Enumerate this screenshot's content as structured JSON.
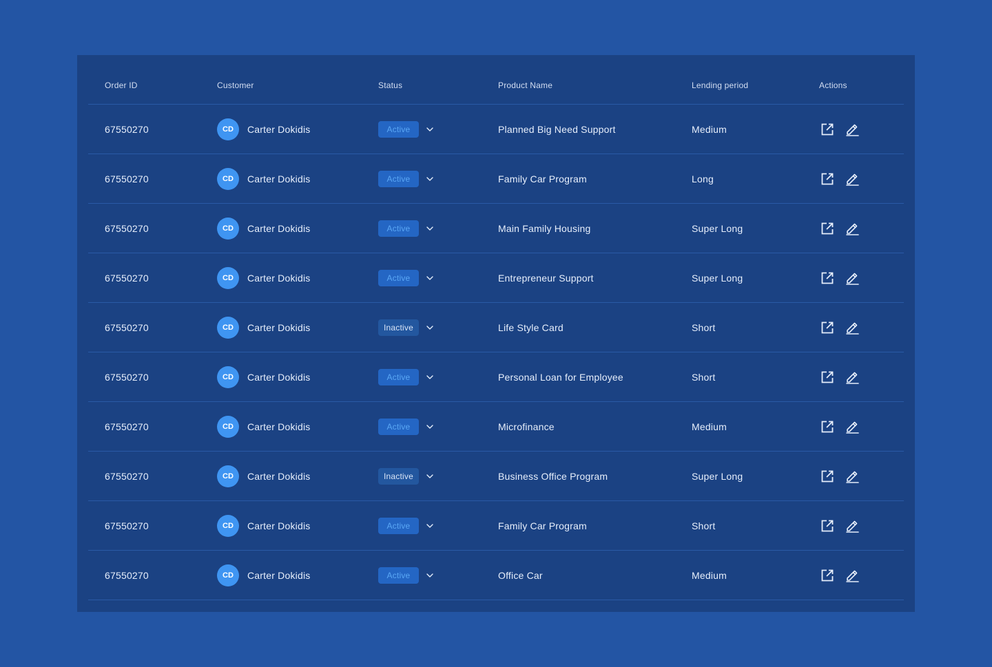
{
  "table": {
    "headers": {
      "order_id": "Order ID",
      "customer": "Customer",
      "status": "Status",
      "product_name": "Product Name",
      "lending_period": "Lending period",
      "actions": "Actions"
    },
    "rows": [
      {
        "order_id": "67550270",
        "initials": "CD",
        "customer": "Carter Dokidis",
        "status": "Active",
        "product": "Planned Big Need Support",
        "period": "Medium"
      },
      {
        "order_id": "67550270",
        "initials": "CD",
        "customer": "Carter Dokidis",
        "status": "Active",
        "product": "Family Car Program",
        "period": "Long"
      },
      {
        "order_id": "67550270",
        "initials": "CD",
        "customer": "Carter Dokidis",
        "status": "Active",
        "product": "Main Family Housing",
        "period": "Super Long"
      },
      {
        "order_id": "67550270",
        "initials": "CD",
        "customer": "Carter Dokidis",
        "status": "Active",
        "product": "Entrepreneur Support",
        "period": "Super Long"
      },
      {
        "order_id": "67550270",
        "initials": "CD",
        "customer": "Carter Dokidis",
        "status": "Inactive",
        "product": "Life Style Card",
        "period": "Short"
      },
      {
        "order_id": "67550270",
        "initials": "CD",
        "customer": "Carter Dokidis",
        "status": "Active",
        "product": "Personal Loan for Employee",
        "period": "Short"
      },
      {
        "order_id": "67550270",
        "initials": "CD",
        "customer": "Carter Dokidis",
        "status": "Active",
        "product": "Microfinance",
        "period": "Medium"
      },
      {
        "order_id": "67550270",
        "initials": "CD",
        "customer": "Carter Dokidis",
        "status": "Inactive",
        "product": "Business Office Program",
        "period": "Super Long"
      },
      {
        "order_id": "67550270",
        "initials": "CD",
        "customer": "Carter Dokidis",
        "status": "Active",
        "product": "Family Car Program",
        "period": "Short"
      },
      {
        "order_id": "67550270",
        "initials": "CD",
        "customer": "Carter Dokidis",
        "status": "Active",
        "product": "Office Car",
        "period": "Medium"
      }
    ]
  },
  "icons": {
    "status_dropdown": "chevron-down-icon",
    "open": "external-link-icon",
    "edit": "pencil-icon"
  },
  "colors": {
    "page_background": "#2355a4",
    "card_background": "#1b4283",
    "row_divider": "#2a5aa6",
    "avatar": "#3f95f2",
    "badge_active_bg": "#2466c4",
    "badge_active_text": "#5aa7f5",
    "badge_inactive_bg": "#23579f",
    "badge_inactive_text": "#d8e4f6"
  }
}
